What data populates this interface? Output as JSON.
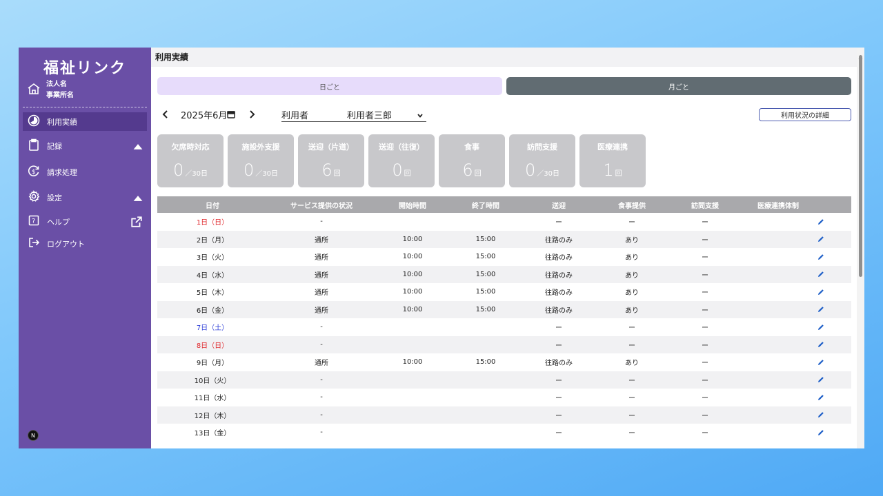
{
  "sidebar": {
    "brand": "福祉リンク",
    "org_name": "法人名",
    "office_name": "事業所名",
    "items": [
      {
        "label": "利用実績"
      },
      {
        "label": "記録"
      },
      {
        "label": "請求処理"
      },
      {
        "label": "設定"
      },
      {
        "label": "ヘルプ"
      },
      {
        "label": "ログアウト"
      }
    ],
    "badge": "N"
  },
  "header": {
    "title": "利用実績"
  },
  "tabs": {
    "day": "日ごと",
    "month": "月ごと"
  },
  "controls": {
    "month": "2025年6月",
    "user_label": "利用者",
    "user_value": "利用者三郎",
    "detail_button": "利用状況の詳細"
  },
  "stats": [
    {
      "title": "欠席時対応",
      "value": "0",
      "unit": "／30日"
    },
    {
      "title": "施設外支援",
      "value": "0",
      "unit": "／30日"
    },
    {
      "title": "送迎（片道）",
      "value": "6",
      "unit": "回"
    },
    {
      "title": "送迎（往復）",
      "value": "0",
      "unit": "回"
    },
    {
      "title": "食事",
      "value": "6",
      "unit": "回"
    },
    {
      "title": "訪問支援",
      "value": "0",
      "unit": "／30日"
    },
    {
      "title": "医療連携",
      "value": "1",
      "unit": "回"
    }
  ],
  "table": {
    "headers": [
      "日付",
      "サービス提供の状況",
      "開始時間",
      "終了時間",
      "送迎",
      "食事提供",
      "訪問支援",
      "医療連携体制"
    ],
    "rows": [
      {
        "date": "1日（日）",
        "status": "-",
        "start": "",
        "end": "",
        "transport": "ー",
        "meal": "ー",
        "visit": "ー",
        "medical": "",
        "day_type": "sun"
      },
      {
        "date": "2日（月）",
        "status": "通所",
        "start": "10:00",
        "end": "15:00",
        "transport": "往路のみ",
        "meal": "あり",
        "visit": "ー",
        "medical": "",
        "day_type": "weekday"
      },
      {
        "date": "3日（火）",
        "status": "通所",
        "start": "10:00",
        "end": "15:00",
        "transport": "往路のみ",
        "meal": "あり",
        "visit": "ー",
        "medical": "",
        "day_type": "weekday"
      },
      {
        "date": "4日（水）",
        "status": "通所",
        "start": "10:00",
        "end": "15:00",
        "transport": "往路のみ",
        "meal": "あり",
        "visit": "ー",
        "medical": "",
        "day_type": "weekday"
      },
      {
        "date": "5日（木）",
        "status": "通所",
        "start": "10:00",
        "end": "15:00",
        "transport": "往路のみ",
        "meal": "あり",
        "visit": "ー",
        "medical": "",
        "day_type": "weekday"
      },
      {
        "date": "6日（金）",
        "status": "通所",
        "start": "10:00",
        "end": "15:00",
        "transport": "往路のみ",
        "meal": "あり",
        "visit": "ー",
        "medical": "",
        "day_type": "weekday"
      },
      {
        "date": "7日（土）",
        "status": "-",
        "start": "",
        "end": "",
        "transport": "ー",
        "meal": "ー",
        "visit": "ー",
        "medical": "",
        "day_type": "sat"
      },
      {
        "date": "8日（日）",
        "status": "-",
        "start": "",
        "end": "",
        "transport": "ー",
        "meal": "ー",
        "visit": "ー",
        "medical": "",
        "day_type": "sun"
      },
      {
        "date": "9日（月）",
        "status": "通所",
        "start": "10:00",
        "end": "15:00",
        "transport": "往路のみ",
        "meal": "あり",
        "visit": "ー",
        "medical": "",
        "day_type": "weekday"
      },
      {
        "date": "10日（火）",
        "status": "-",
        "start": "",
        "end": "",
        "transport": "ー",
        "meal": "ー",
        "visit": "ー",
        "medical": "",
        "day_type": "weekday"
      },
      {
        "date": "11日（水）",
        "status": "-",
        "start": "",
        "end": "",
        "transport": "ー",
        "meal": "ー",
        "visit": "ー",
        "medical": "",
        "day_type": "weekday"
      },
      {
        "date": "12日（木）",
        "status": "-",
        "start": "",
        "end": "",
        "transport": "ー",
        "meal": "ー",
        "visit": "ー",
        "medical": "",
        "day_type": "weekday"
      },
      {
        "date": "13日（金）",
        "status": "-",
        "start": "",
        "end": "",
        "transport": "ー",
        "meal": "ー",
        "visit": "ー",
        "medical": "",
        "day_type": "weekday"
      }
    ]
  },
  "colors": {
    "sidebar": "#6a4fa6",
    "sidebar_active": "#543a8e",
    "tab_day": "#e7dcfb",
    "tab_month": "#616c72",
    "stat_card": "#c8c8cb",
    "table_header": "#a9a9ac",
    "sunday": "#e0282c",
    "saturday": "#2e3fd8",
    "edit_icon": "#1e5fc8"
  }
}
